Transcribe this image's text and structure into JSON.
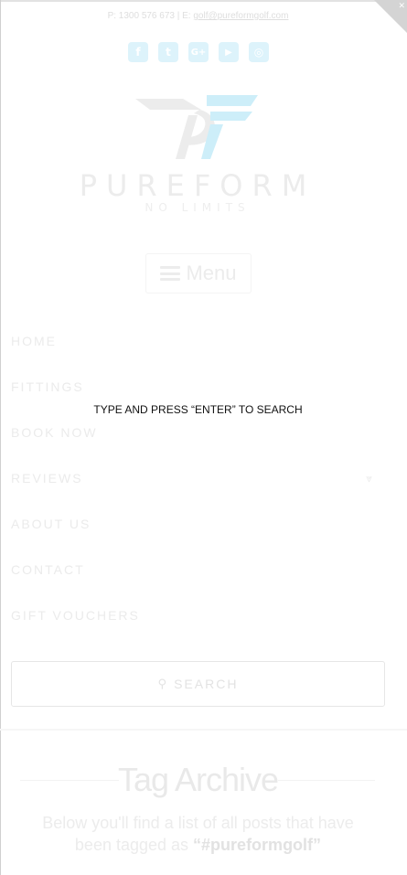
{
  "header": {
    "contact_phone": "P: 1300 576 673 | E: ",
    "contact_email": "golf@pureformgolf.com",
    "social_icons": [
      "facebook-icon",
      "twitter-icon",
      "google-plus-icon",
      "youtube-icon",
      "instagram-icon"
    ],
    "social_glyphs": [
      "f",
      "t",
      "G+",
      "▶",
      "◎"
    ],
    "logo_word": "PUREFORM",
    "logo_tagline": "NO LIMITS"
  },
  "menu": {
    "toggle_label": "Menu",
    "items": [
      {
        "label": "HOME"
      },
      {
        "label": "FITTINGS"
      },
      {
        "label": "BOOK NOW"
      },
      {
        "label": "REVIEWS",
        "has_submenu": true
      },
      {
        "label": "ABOUT US"
      },
      {
        "label": "CONTACT"
      },
      {
        "label": "GIFT VOUCHERS"
      }
    ],
    "chevron_glyph": "⩔"
  },
  "search": {
    "button_label": "SEARCH",
    "icon_glyph": "⚲",
    "overlay_prompt": "TYPE AND PRESS “ENTER” TO SEARCH"
  },
  "archive": {
    "title": "Tag Archive",
    "desc_prefix": "Below you'll find a list of all posts that have been tagged as ",
    "desc_tag": "“#pureformgolf”"
  },
  "colors": {
    "logo_light_blue": "#cdeef9",
    "logo_grey": "#ececec",
    "social_bg": "#ddf3fb",
    "overlay_text": "#111111"
  }
}
